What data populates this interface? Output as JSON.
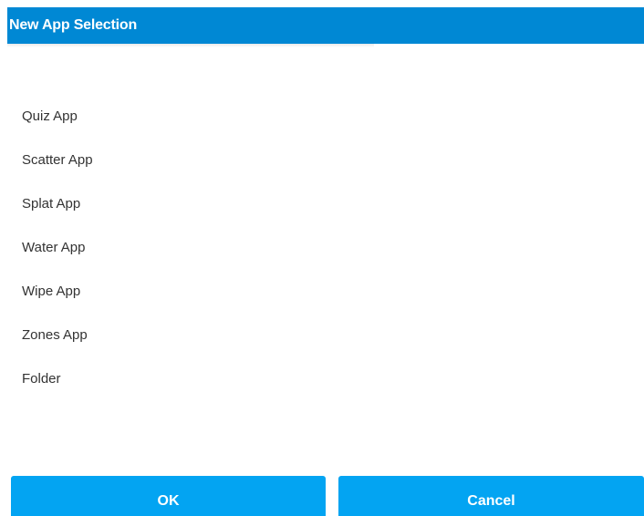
{
  "dialog": {
    "title": "New App Selection"
  },
  "apps": [
    {
      "label": "Quiz App"
    },
    {
      "label": "Scatter App"
    },
    {
      "label": "Splat App"
    },
    {
      "label": "Water App"
    },
    {
      "label": "Wipe App"
    },
    {
      "label": "Zones App"
    },
    {
      "label": "Folder"
    }
  ],
  "buttons": {
    "ok_label": "OK",
    "cancel_label": "Cancel"
  },
  "colors": {
    "title_bar": "#0088d4",
    "button": "#03a4f2",
    "text": "#333333"
  }
}
